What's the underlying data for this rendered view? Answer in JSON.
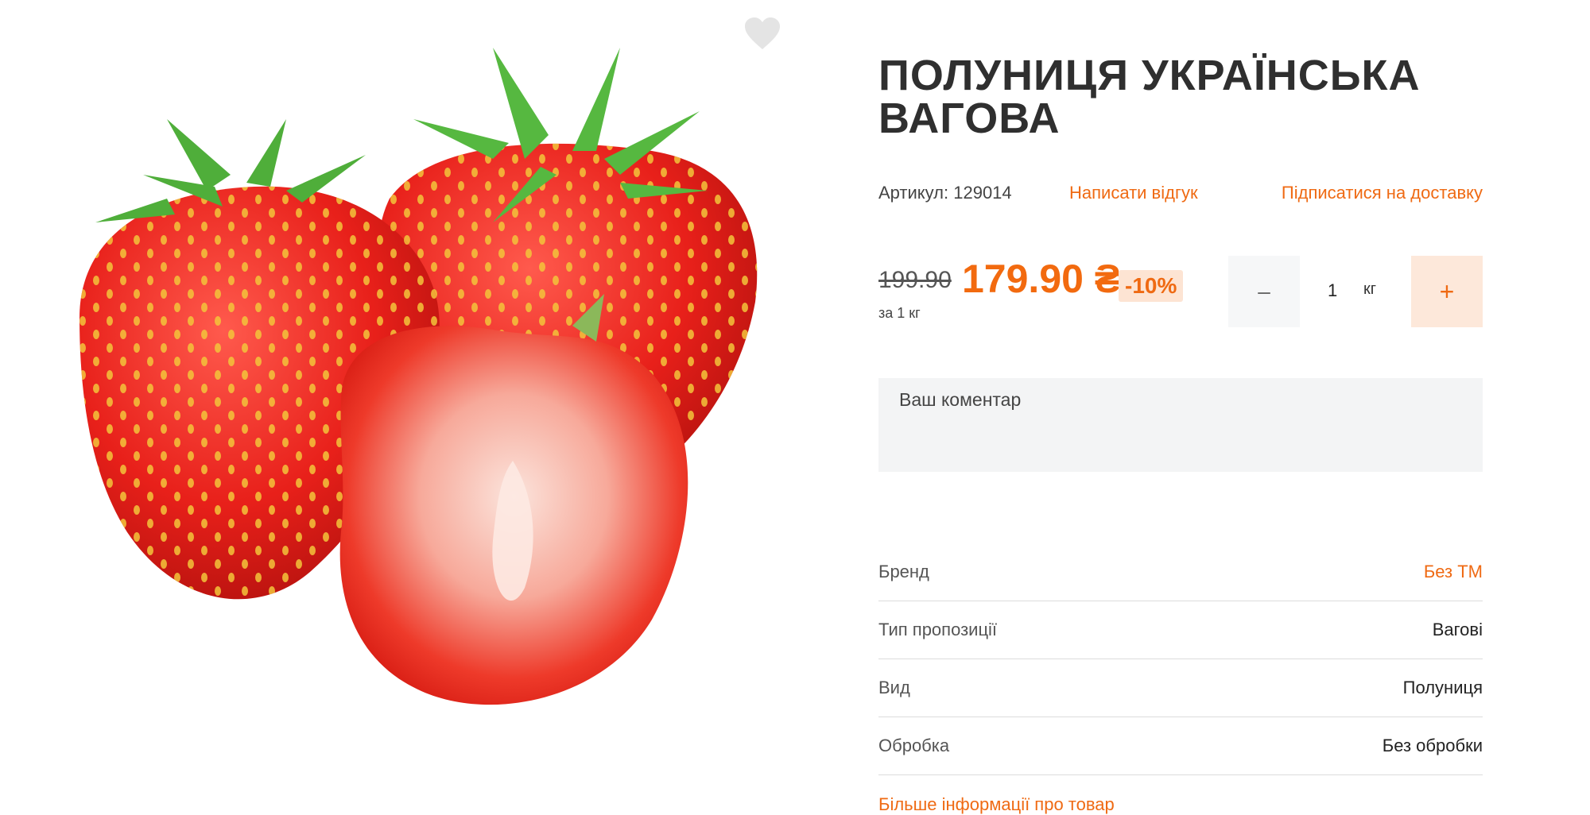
{
  "product": {
    "title": "ПОЛУНИЦЯ УКРАЇНСЬКА ВАГОВА",
    "sku_text": "Артикул: 129014",
    "review_link": "Написати відгук",
    "subscribe_link": "Підписатися на доставку",
    "image_name": "strawberries-photo",
    "favorite_icon": "heart-icon"
  },
  "price": {
    "old": "199.90",
    "current": "179.90 ₴",
    "discount": "-10%",
    "per_unit": "за 1 кг"
  },
  "quantity": {
    "minus_icon": "minus-icon",
    "value": "1",
    "unit": "кг",
    "plus_icon": "plus-icon"
  },
  "comment": {
    "placeholder": "Ваш коментар"
  },
  "specs": [
    {
      "key": "Бренд",
      "value": "Без ТМ"
    },
    {
      "key": "Тип пропозиції",
      "value": "Вагові"
    },
    {
      "key": "Вид",
      "value": "Полуниця"
    },
    {
      "key": "Обробка",
      "value": "Без обробки"
    }
  ],
  "more_link": "Більше інформації про товар",
  "colors": {
    "accent": "#ef6a13",
    "accent_light": "#fde8da",
    "text": "#2b2b2b",
    "input_bg": "#f3f4f5"
  }
}
